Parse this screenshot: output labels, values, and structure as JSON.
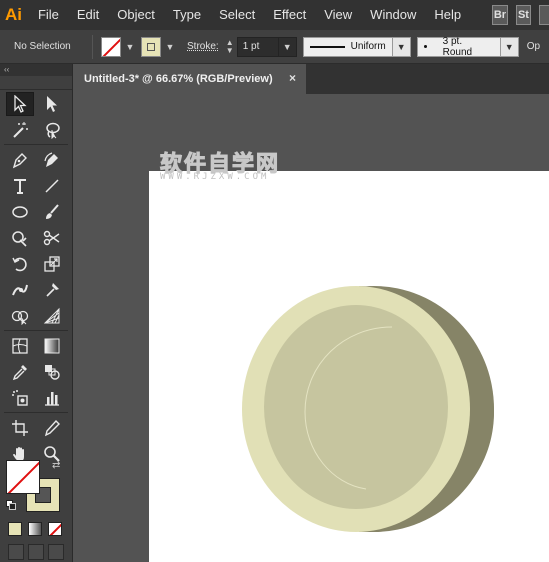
{
  "app": {
    "logo": "Ai"
  },
  "menu": [
    "File",
    "Edit",
    "Object",
    "Type",
    "Select",
    "Effect",
    "View",
    "Window",
    "Help"
  ],
  "app_buttons": [
    "Br",
    "St"
  ],
  "control_bar": {
    "selection_label": "No Selection",
    "stroke_label": "Stroke:",
    "stroke_weight": "1 pt",
    "variable_width_profile": "Uniform",
    "brush": "3 pt. Round",
    "opacity_label": "Op",
    "fill_state": "none",
    "stroke_color": "#e6e3b6"
  },
  "toolbar": {
    "collapse_glyph": "‹‹",
    "tools": [
      "selection-tool",
      "direct-selection-tool",
      "magic-wand-tool",
      "lasso-tool",
      "pen-tool",
      "curvature-tool",
      "type-tool",
      "line-segment-tool",
      "ellipse-tool",
      "paintbrush-tool",
      "shaper-tool",
      "scissors-tool",
      "rotate-tool",
      "scale-tool",
      "width-tool",
      "puppet-warp-tool",
      "shape-builder-tool",
      "perspective-grid-tool",
      "mesh-tool",
      "gradient-tool",
      "eyedropper-tool",
      "blend-tool",
      "symbol-sprayer-tool",
      "column-graph-tool",
      "artboard-tool",
      "slice-tool",
      "hand-tool",
      "zoom-tool"
    ],
    "active_tool": "selection-tool",
    "swap_glyph": "⇄"
  },
  "document_tab": {
    "title": "Untitled-3* @ 66.67% (RGB/Preview)",
    "close_glyph": "×"
  },
  "canvas": {
    "watermark_main": "软件自学网",
    "watermark_sub": "WWW.RJZXW.COM",
    "colors": {
      "coin_face": "#e1e0b6",
      "coin_inner": "#c6c59f",
      "coin_side": "#868467",
      "inner_arc": "#e4e3c2"
    }
  }
}
